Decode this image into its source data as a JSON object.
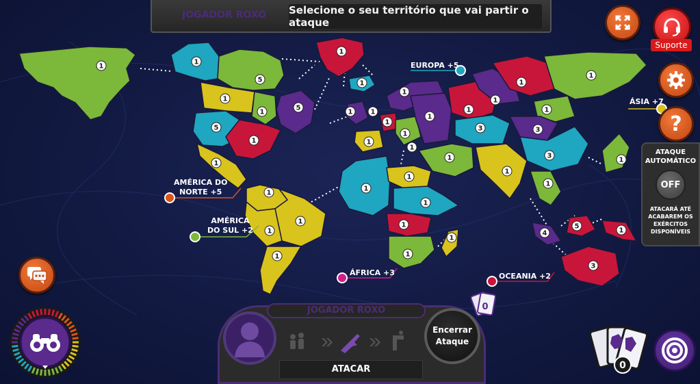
{
  "top_bar": {
    "player_name": "JOGADOR ROXO",
    "message": "Selecione o seu território que vai partir o ataque"
  },
  "buttons": {
    "fullscreen_icon": "expand-arrows-icon",
    "support_icon": "headset-icon",
    "support_label": "Suporte",
    "settings_icon": "gear-icon",
    "help_label": "?",
    "chat_icon": "chat-bubbles-icon"
  },
  "auto_attack": {
    "title": "ATAQUE AUTOMÁTICO",
    "toggle": "OFF",
    "description": "ATACARÁ ATÉ ACABAREM OS EXÉRCITOS DISPONÍVEIS"
  },
  "continents": {
    "europa": "EUROPA +5",
    "asia": "ÁSIA +7",
    "america_norte_line1": "AMÉRICA DO",
    "america_norte_line2": "NORTE +5",
    "america_sul_line1": "AMÉRICA",
    "america_sul_line2": "DO SUL +2",
    "africa": "ÁFRICA +3",
    "oceania": "OCEANIA +2"
  },
  "colors": {
    "green": "#7cb83a",
    "cyan": "#1fa6c0",
    "yellow": "#d9c31d",
    "purple": "#5a2a8c",
    "red": "#c8163a",
    "accent_orange": "#d9551c",
    "support_red": "#d91a1a"
  },
  "territory_armies": [
    "1",
    "1",
    "5",
    "1",
    "5",
    "5",
    "1",
    "1",
    "1",
    "1",
    "1",
    "1",
    "1",
    "1",
    "1",
    "1",
    "1",
    "1",
    "1",
    "1",
    "1",
    "1",
    "1",
    "1",
    "1",
    "1",
    "1",
    "1",
    "1",
    "3",
    "3",
    "3",
    "1",
    "1",
    "1",
    "1",
    "1",
    "1",
    "1",
    "1",
    "1",
    "4",
    "5",
    "1",
    "3"
  ],
  "hud": {
    "player_name": "JOGADOR ROXO",
    "phase_icons": [
      "troops-icon",
      "chevrons-icon",
      "rifle-icon",
      "chevrons-icon",
      "move-icon"
    ],
    "phase_label": "ATACAR",
    "end_attack_line1": "Encerrar",
    "end_attack_line2": "Ataque",
    "small_card_count": "0",
    "cards_count": "0",
    "objective_icon": "target-icon",
    "binoculars_icon": "binoculars-icon"
  }
}
